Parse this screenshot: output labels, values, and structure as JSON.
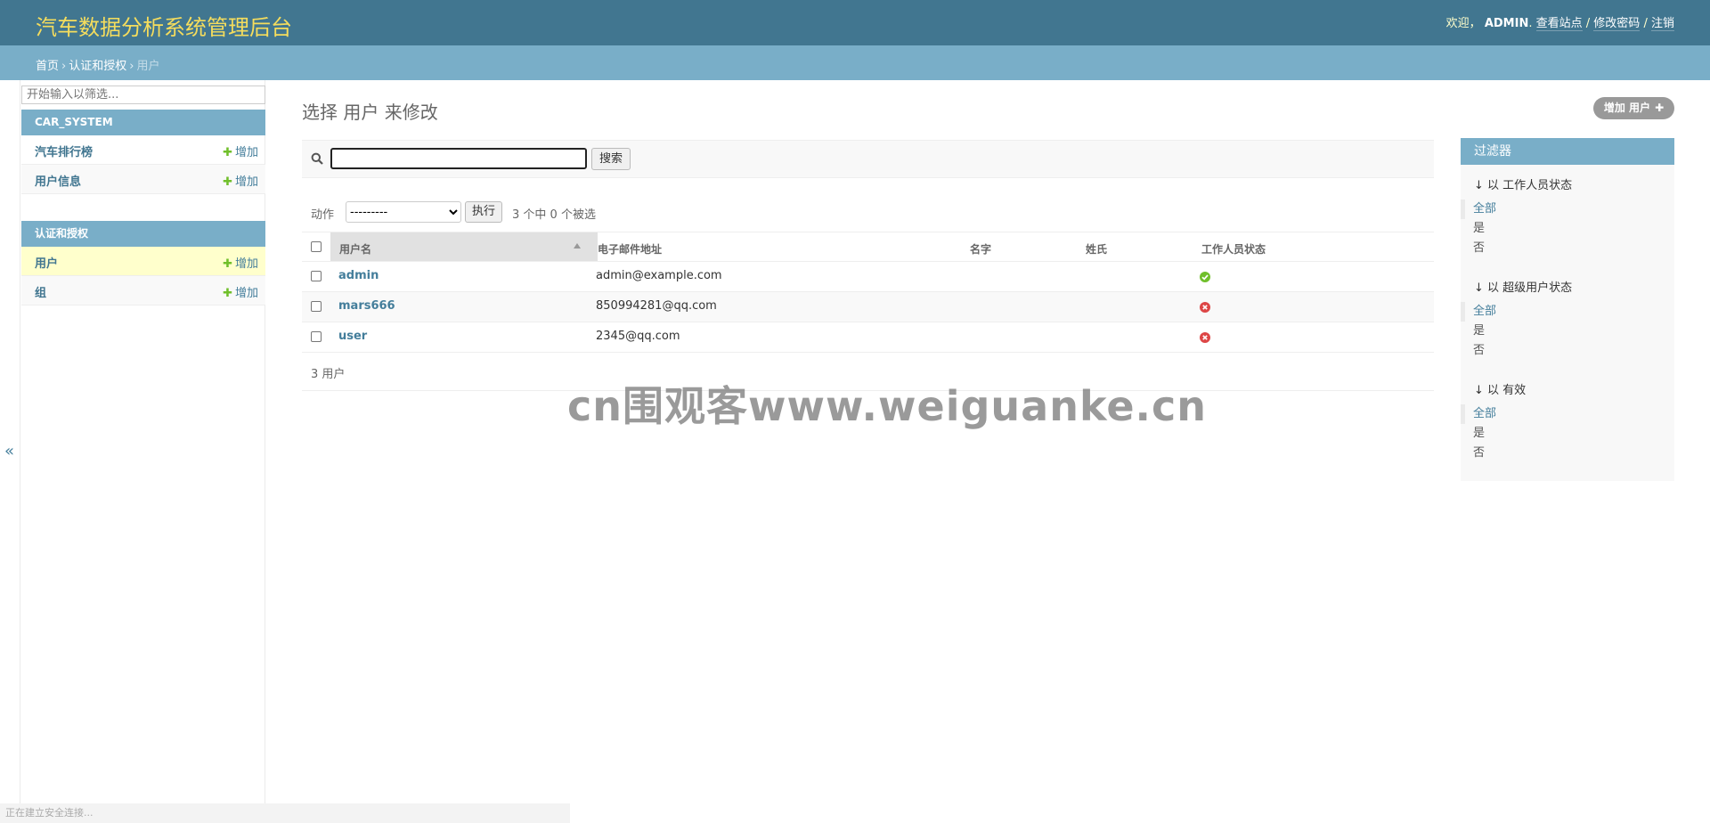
{
  "header": {
    "site_title": "汽车数据分析系统管理后台",
    "welcome": "欢迎，",
    "username": "ADMIN",
    "view_site": "查看站点",
    "change_password": "修改密码",
    "logout": "注销",
    "sep": "/"
  },
  "breadcrumb": {
    "home": "首页",
    "section": "认证和授权",
    "current": "用户",
    "sep": "›"
  },
  "sidebar": {
    "filter_placeholder": "开始输入以筛选...",
    "modules": [
      {
        "caption": "CAR_SYSTEM",
        "items": [
          {
            "label": "汽车排行榜",
            "add": "增加"
          },
          {
            "label": "用户信息",
            "add": "增加"
          }
        ]
      },
      {
        "caption": "认证和授权",
        "items": [
          {
            "label": "用户",
            "add": "增加"
          },
          {
            "label": "组",
            "add": "增加"
          }
        ]
      }
    ],
    "collapse_glyph": "«"
  },
  "content": {
    "title": "选择 用户 来修改",
    "add_button": "增加 用户",
    "search_button": "搜索",
    "action_label": "动作",
    "action_placeholder": "---------",
    "go_button": "执行",
    "selection_counter": "3 个中 0 个被选",
    "columns": [
      "用户名",
      "电子邮件地址",
      "名字",
      "姓氏",
      "工作人员状态"
    ],
    "rows": [
      {
        "username": "admin",
        "email": "admin@example.com",
        "first_name": "",
        "last_name": "",
        "staff": true
      },
      {
        "username": "mars666",
        "email": "850994281@qq.com",
        "first_name": "",
        "last_name": "",
        "staff": false
      },
      {
        "username": "user",
        "email": "2345@qq.com",
        "first_name": "",
        "last_name": "",
        "staff": false
      }
    ],
    "paginator": "3 用户"
  },
  "filter": {
    "heading": "过滤器",
    "groups": [
      {
        "title": "↓ 以 工作人员状态",
        "options": [
          "全部",
          "是",
          "否"
        ]
      },
      {
        "title": "↓ 以 超级用户状态",
        "options": [
          "全部",
          "是",
          "否"
        ]
      },
      {
        "title": "↓ 以 有效",
        "options": [
          "全部",
          "是",
          "否"
        ]
      }
    ]
  },
  "status_bar": "正在建立安全连接...",
  "watermark": "cn围观客www.weiguanke.cn",
  "colors": {
    "header_bg": "#417690",
    "breadcrumb_bg": "#79aec8",
    "site_title": "#f5dd5d",
    "link": "#447e9b",
    "add_plus": "#70bf2b",
    "status_yes": "#70bf2b",
    "status_no": "#dd4646",
    "selected_row": "#ffffcc"
  }
}
